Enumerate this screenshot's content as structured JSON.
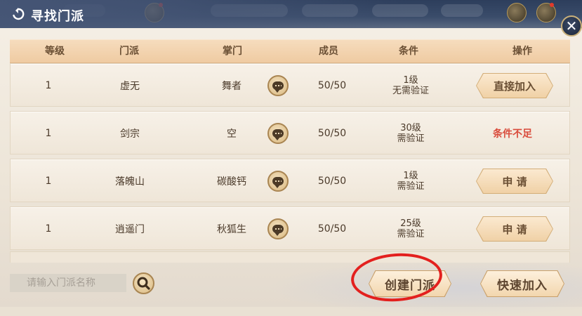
{
  "window": {
    "title": "寻找门派"
  },
  "table": {
    "headers": [
      "等级",
      "门派",
      "掌门",
      "成员",
      "条件",
      "操作"
    ],
    "rows": [
      {
        "level": "1",
        "sect": "虚无",
        "leader": "舞者",
        "members": "50/50",
        "cond_level": "1级",
        "cond_verify": "无需验证",
        "action": "直接加入",
        "action_type": "button"
      },
      {
        "level": "1",
        "sect": "剑宗",
        "leader": "空",
        "members": "50/50",
        "cond_level": "30级",
        "cond_verify": "需验证",
        "action": "条件不足",
        "action_type": "text"
      },
      {
        "level": "1",
        "sect": "落魄山",
        "leader": "碳酸钙",
        "members": "50/50",
        "cond_level": "1级",
        "cond_verify": "需验证",
        "action": "申 请",
        "action_type": "button"
      },
      {
        "level": "1",
        "sect": "逍遥门",
        "leader": "秋狐生",
        "members": "50/50",
        "cond_level": "25级",
        "cond_verify": "需验证",
        "action": "申 请",
        "action_type": "button"
      }
    ]
  },
  "search": {
    "placeholder": "请输入门派名称"
  },
  "buttons": {
    "create": "创建门派",
    "quick_join": "快速加入",
    "close": "✕"
  },
  "icons": {
    "back": "back-arrow-icon",
    "chat": "chat-bubble-icon",
    "search": "magnifier-icon",
    "close": "close-icon"
  },
  "colors": {
    "accent": "#6a4f34",
    "fail": "#d94a3a",
    "highlight_circle": "#e3201e"
  }
}
